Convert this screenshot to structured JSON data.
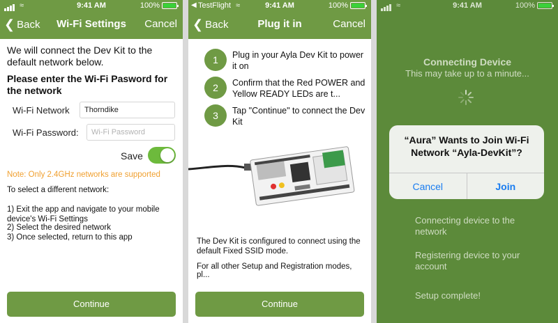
{
  "colors": {
    "header": "#6f9a44",
    "accent_button": "#6f9a44",
    "toggle_on": "#6dba3c",
    "note": "#f0a030",
    "phone3_bg": "#5c8a3a",
    "alert_button": "#1a7df0"
  },
  "screen1": {
    "status": {
      "time": "9:41 AM",
      "battery": "100%",
      "battery_level": 1.0
    },
    "nav": {
      "back": "Back",
      "title": "Wi-Fi Settings",
      "cancel": "Cancel"
    },
    "intro": "We will connect the Dev Kit to the default network below.",
    "prompt": "Please enter the Wi-Fi Pasword for the network",
    "network_label": "Wi-Fi Network",
    "network_value": "Thorndike",
    "password_label": "Wi-Fi Password:",
    "password_placeholder": "Wi-Fi Password",
    "save_label": "Save",
    "save_on": true,
    "note": "Note: Only 2.4GHz networks are supported",
    "instructions_title": "To select a different network:",
    "instructions": [
      "1) Exit the app and navigate to your mobile device's Wi-Fi Settings",
      "2) Select the desired network",
      "3) Once selected, return to this app"
    ],
    "continue": "Continue"
  },
  "screen2": {
    "status": {
      "carrier": "TestFlight",
      "time": "9:41 AM",
      "battery": "100%",
      "battery_level": 1.0
    },
    "nav": {
      "back": "Back",
      "title": "Plug it in",
      "cancel": "Cancel"
    },
    "steps": [
      {
        "num": "1",
        "text": "Plug in your Ayla Dev Kit to power it on"
      },
      {
        "num": "2",
        "text": "Confirm that the Red POWER and Yellow READY LEDs are t..."
      },
      {
        "num": "3",
        "text": "Tap \"Continue\" to connect the Dev Kit"
      }
    ],
    "para1": "The Dev Kit is configured to connect using the default Fixed SSID mode.",
    "para2": "For all other Setup and Registration modes, pl...",
    "continue": "Continue"
  },
  "screen3": {
    "status": {
      "time": "9:41 AM",
      "battery": "100%",
      "battery_level": 1.0
    },
    "title": "Connecting Device",
    "subtitle": "This may take up to a minute...",
    "alert": {
      "message": "“Aura” Wants to Join Wi-Fi Network “Ayla-DevKit”?",
      "cancel": "Cancel",
      "join": "Join"
    },
    "steps": [
      "Connecting device to the network",
      "Registering device to your account",
      "Setup complete!"
    ]
  }
}
